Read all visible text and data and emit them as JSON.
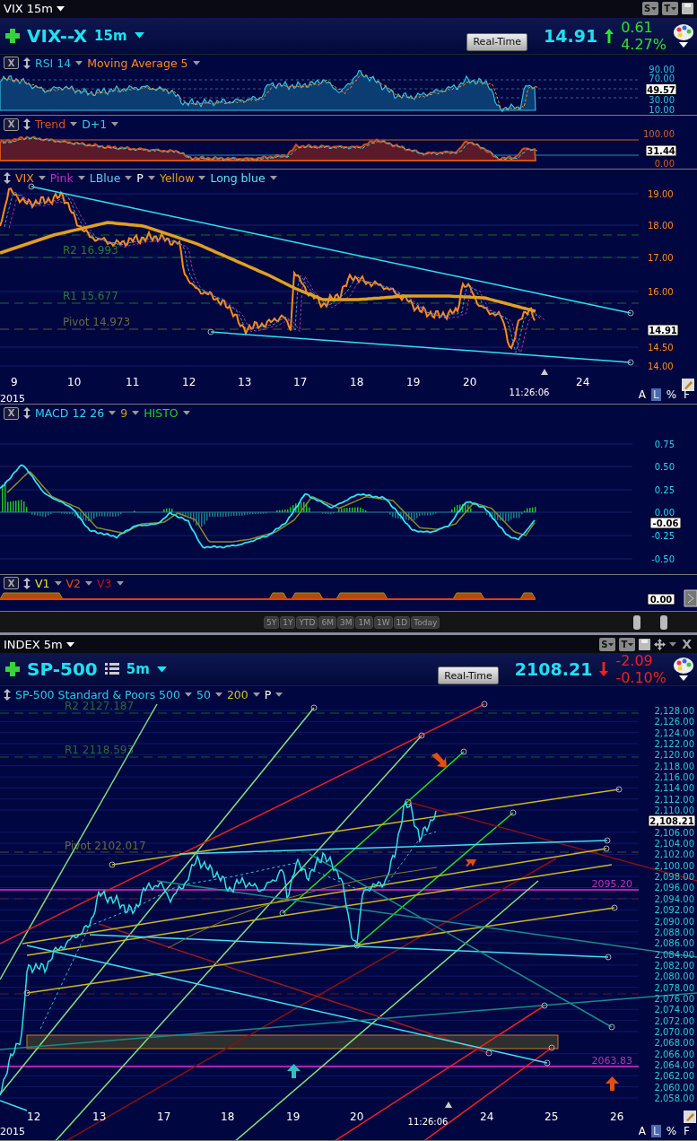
{
  "vix_window": {
    "title": "VIX 15m",
    "tool_buttons": [
      "S",
      "T"
    ],
    "symbol": "VIX--X",
    "interval": "15m",
    "realtime_button": "Real-Time",
    "price": "14.91",
    "change": "0.61",
    "change_percent": "4.27%",
    "rising": true
  },
  "rsi_panel": {
    "close": "X",
    "legend": [
      {
        "label": "RSI 14",
        "color": "#30c0e0"
      },
      {
        "label": "Moving Average 5",
        "color": "#ff8c1a"
      }
    ],
    "axis": [
      "90.00",
      "70.00",
      "30.00",
      "10.00"
    ],
    "current": "49.57"
  },
  "trend_panel": {
    "close": "X",
    "legend": [
      {
        "label": "Trend",
        "color": "#e0501a"
      },
      {
        "label": "D+1",
        "color": "#30d0f0"
      }
    ],
    "axis": [
      "100.00",
      "0.00"
    ],
    "current": "31.44"
  },
  "vix_price_panel": {
    "legend": [
      {
        "label": "VIX",
        "color": "#ff8c1a"
      },
      {
        "label": "Pink",
        "color": "#c030c0"
      },
      {
        "label": "LBlue",
        "color": "#60c8f0"
      },
      {
        "label": "P",
        "color": "#ffffff"
      },
      {
        "label": "Yellow",
        "color": "#e0a020"
      },
      {
        "label": "Long blue",
        "color": "#60e0f0"
      }
    ],
    "pivots": [
      "R2 16.993",
      "R1 15.677",
      "Pivot 14.973"
    ],
    "axis": [
      "19.00",
      "18.00",
      "17.00",
      "16.00",
      "14.50",
      "14.00"
    ],
    "current": "14.91",
    "dates": [
      "9",
      "10",
      "11",
      "12",
      "13",
      "17",
      "18",
      "19",
      "20",
      "24"
    ],
    "year": "2015",
    "time": "11:26:06",
    "scale_options": [
      {
        "label": "A",
        "selected": false
      },
      {
        "label": "L",
        "selected": true
      },
      {
        "label": "%",
        "selected": false
      },
      {
        "label": "F",
        "selected": false
      }
    ]
  },
  "macd_panel": {
    "close": "X",
    "legend": [
      {
        "label": "MACD 12 26",
        "color": "#30d0f0"
      },
      {
        "label": "9",
        "color": "#c0a020"
      },
      {
        "label": "HISTO",
        "color": "#20d020"
      }
    ],
    "axis": [
      "0.75",
      "0.50",
      "0.25",
      "0.00",
      "-0.25",
      "-0.50"
    ],
    "current": "-0.06"
  },
  "volume_panel": {
    "close": "X",
    "legend": [
      {
        "label": "V1",
        "color": "#f0e020"
      },
      {
        "label": "V2",
        "color": "#e05010"
      },
      {
        "label": "V3",
        "color": "#c01010"
      }
    ],
    "current": "0.00"
  },
  "range_buttons": [
    "5Y",
    "1Y",
    "YTD",
    "6M",
    "3M",
    "1M",
    "1W",
    "1D",
    "Today"
  ],
  "sp_window": {
    "title": "INDEX 5m",
    "tool_buttons": [
      "S",
      "T"
    ],
    "close": "X",
    "symbol": "SP-500",
    "interval": "5m",
    "realtime_button": "Real-Time",
    "price": "2108.21",
    "change": "-2.09",
    "change_percent": "-0.10%",
    "rising": false
  },
  "sp_chart": {
    "legend": [
      {
        "label": "SP-500 Standard & Poors 500",
        "color": "#30c8e0"
      },
      {
        "label": "50",
        "color": "#30c8e0"
      },
      {
        "label": "200",
        "color": "#d0c020"
      },
      {
        "label": "P",
        "color": "#ffffff"
      }
    ],
    "pivots": [
      "R2 2127.187",
      "R1 2118.593",
      "Pivot 2102.017"
    ],
    "axis": [
      "2,128.00",
      "2,126.00",
      "2,124.00",
      "2,122.00",
      "2,120.00",
      "2,118.00",
      "2,116.00",
      "2,114.00",
      "2,112.00",
      "2,110.00",
      "2,106.00",
      "2,104.00",
      "2,102.00",
      "2,100.00",
      "2,098.00",
      "2,096.00",
      "2,094.00",
      "2,092.00",
      "2,090.00",
      "2,088.00",
      "2,086.00",
      "2,084.00",
      "2,082.00",
      "2,080.00",
      "2,078.00",
      "2,076.00",
      "2,074.00",
      "2,072.00",
      "2,070.00",
      "2,068.00",
      "2,066.00",
      "2,064.00",
      "2,062.00",
      "2,060.00",
      "2,058.00"
    ],
    "current": "2,108.21",
    "levels": [
      "2095.20",
      "2063.83"
    ],
    "dates": [
      "12",
      "13",
      "17",
      "18",
      "19",
      "20",
      "24",
      "25",
      "26"
    ],
    "year": "2015",
    "time": "11:26:06",
    "scale_options": [
      {
        "label": "A",
        "selected": false
      },
      {
        "label": "L",
        "selected": true
      },
      {
        "label": "%",
        "selected": false
      },
      {
        "label": "F",
        "selected": false
      }
    ]
  }
}
